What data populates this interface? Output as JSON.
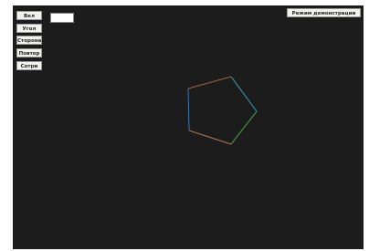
{
  "controls": {
    "buttons": [
      {
        "name": "on-button",
        "label": "Вкл"
      },
      {
        "name": "angle-button",
        "label": "Угол"
      },
      {
        "name": "side-button",
        "label": "Сторона"
      },
      {
        "name": "repeat-button",
        "label": "Повтор"
      },
      {
        "name": "erase-button",
        "label": "Сотри"
      }
    ],
    "input_value": "",
    "demo_label": "Режим демонстрации"
  },
  "drawing": {
    "shape": "pentagon",
    "background_color": "#1c1c1c",
    "edge_colors": [
      "#a0643c",
      "#3aa0b4",
      "#4aa84a",
      "#b07850",
      "#3c78b4"
    ]
  }
}
